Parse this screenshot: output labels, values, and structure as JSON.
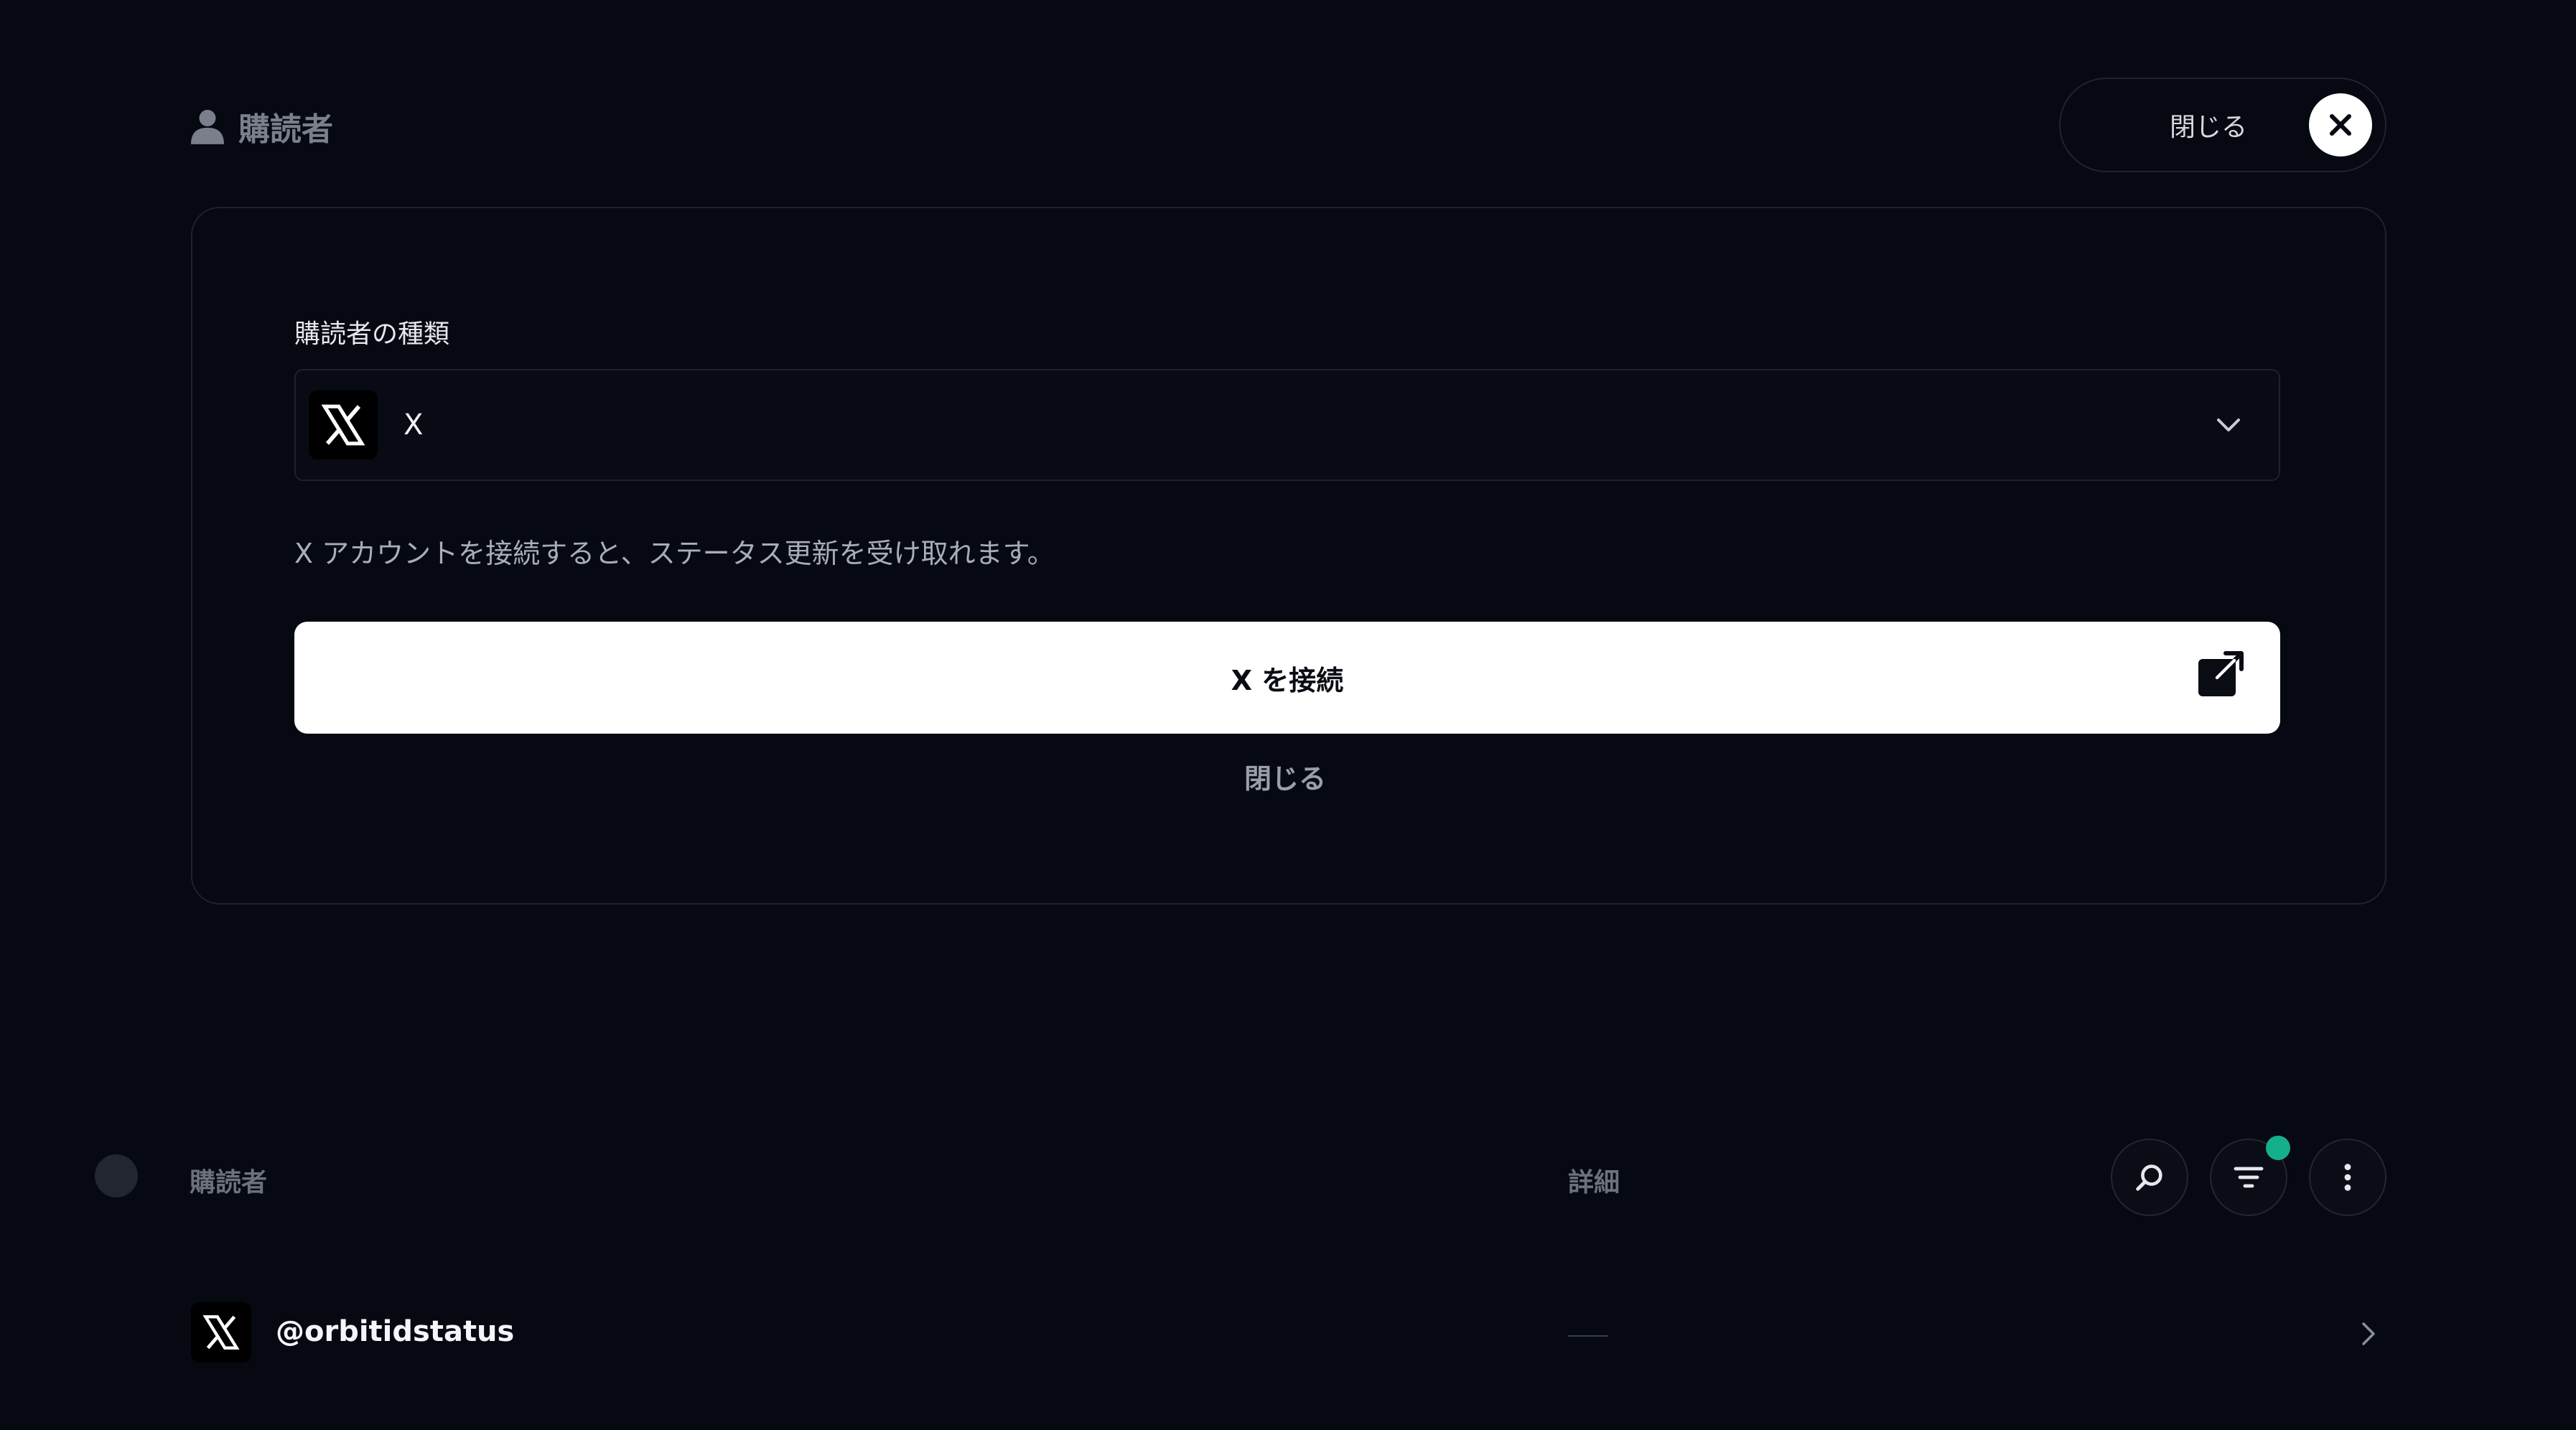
{
  "header": {
    "title": "購読者",
    "close_label": "閉じる"
  },
  "form": {
    "field_label": "購読者の種類",
    "selected_value": "X",
    "helper_text": "X アカウントを接続すると、ステータス更新を受け取れます。",
    "connect_label": "X を接続",
    "close_label": "閉じる"
  },
  "table": {
    "columns": [
      "購読者",
      "詳細"
    ],
    "rows": [
      {
        "handle": "@orbitidstatus",
        "details": "—"
      }
    ]
  },
  "colors": {
    "background": "#060812",
    "filter_indicator": "#14b08c"
  },
  "icons": {
    "header": "user-icon",
    "close": "close-icon",
    "select_icon": "x-logo-icon",
    "dropdown": "chevron-down-icon",
    "external": "external-link-icon",
    "search": "search-icon",
    "filter": "filter-icon",
    "more": "more-vertical-icon",
    "row_chevron": "chevron-right-icon"
  }
}
